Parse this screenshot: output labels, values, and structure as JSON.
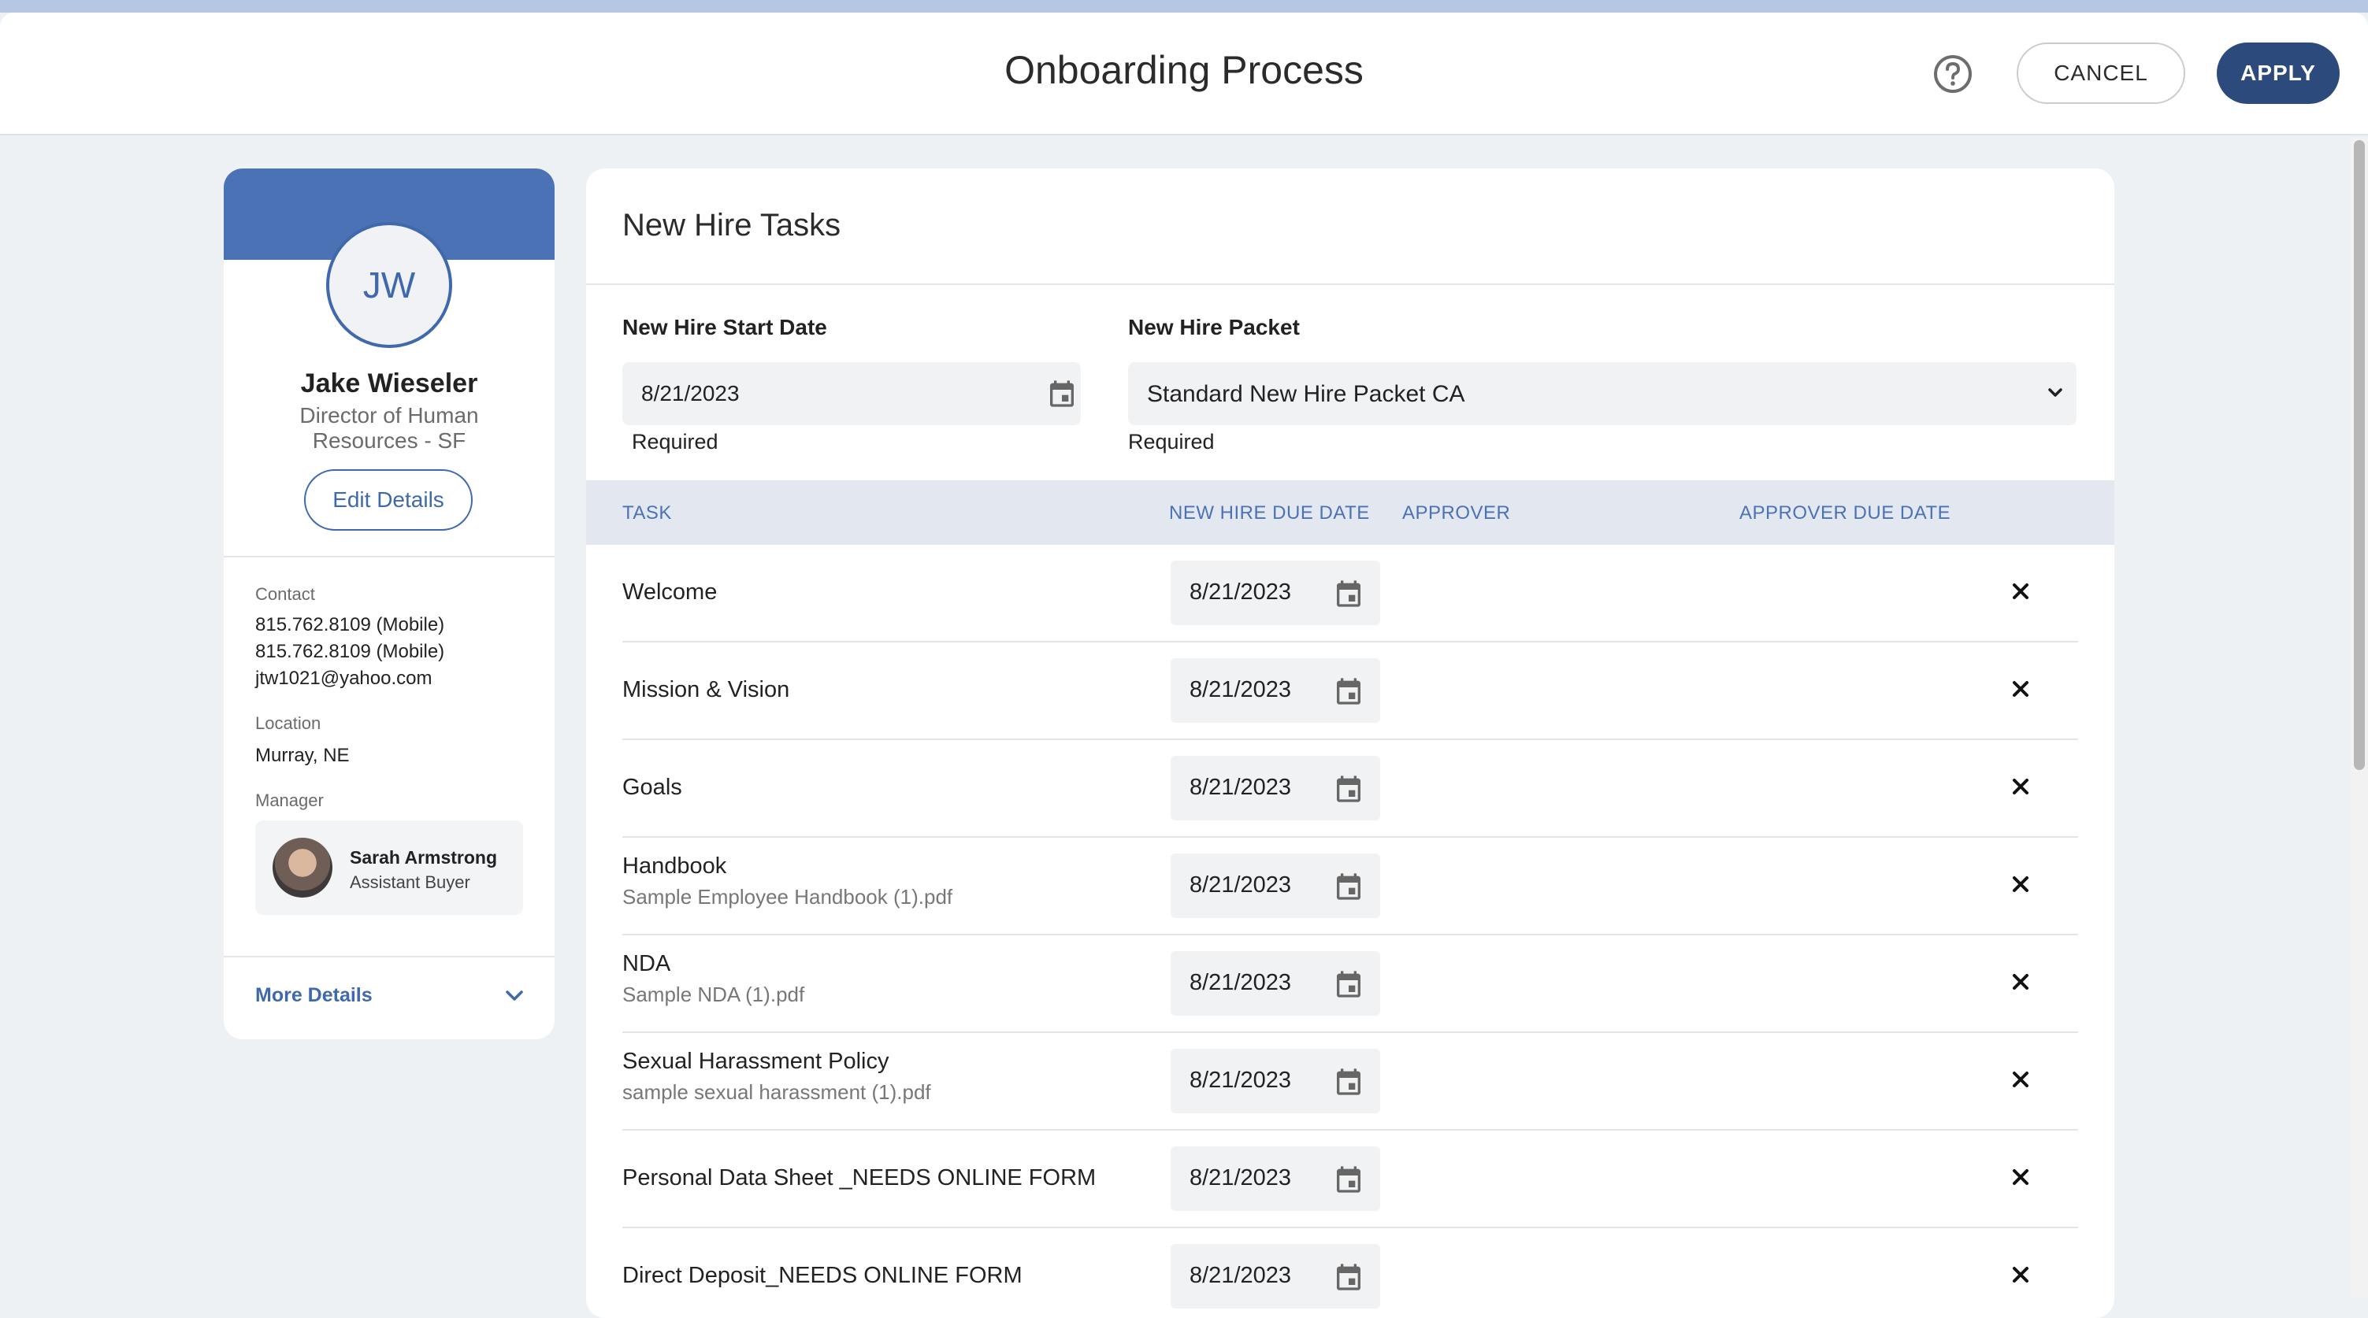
{
  "header": {
    "title": "Onboarding Process",
    "help_icon": "help-circle-icon",
    "cancel_label": "CANCEL",
    "apply_label": "APPLY"
  },
  "profile": {
    "initials": "JW",
    "name": "Jake Wieseler",
    "role": "Director of Human Resources - SF",
    "edit_label": "Edit Details",
    "contact_label": "Contact",
    "contact": [
      "815.762.8109 (Mobile)",
      "815.762.8109 (Mobile)",
      "jtw1021@yahoo.com"
    ],
    "location_label": "Location",
    "location": "Murray, NE",
    "manager_label": "Manager",
    "manager_name": "Sarah Armstrong",
    "manager_title": "Assistant Buyer",
    "more_details_label": "More Details"
  },
  "tasks": {
    "title": "New Hire Tasks",
    "start_date_label": "New Hire Start Date",
    "start_date_value": "8/21/2023",
    "packet_label": "New Hire Packet",
    "packet_value": "Standard New Hire Packet CA",
    "required_text": "Required",
    "columns": {
      "task": "TASK",
      "due": "NEW HIRE DUE DATE",
      "approver": "APPROVER",
      "approver_due": "APPROVER DUE DATE"
    },
    "rows": [
      {
        "name": "Welcome",
        "file": "",
        "date": "8/21/2023"
      },
      {
        "name": "Mission & Vision",
        "file": "",
        "date": "8/21/2023"
      },
      {
        "name": "Goals",
        "file": "",
        "date": "8/21/2023"
      },
      {
        "name": "Handbook",
        "file": "Sample Employee Handbook (1).pdf",
        "date": "8/21/2023"
      },
      {
        "name": "NDA",
        "file": "Sample NDA (1).pdf",
        "date": "8/21/2023"
      },
      {
        "name": "Sexual Harassment Policy",
        "file": "sample sexual harassment (1).pdf",
        "date": "8/21/2023"
      },
      {
        "name": "Personal Data Sheet _NEEDS ONLINE FORM",
        "file": "",
        "date": "8/21/2023"
      },
      {
        "name": "Direct Deposit_NEEDS ONLINE FORM",
        "file": "",
        "date": "8/21/2023"
      }
    ]
  },
  "colors": {
    "accent": "#2c4a7c",
    "banner": "#4a72b4",
    "link": "#3f68ad",
    "table_header_bg": "#e3e8f0",
    "background": "#eef1f4"
  }
}
